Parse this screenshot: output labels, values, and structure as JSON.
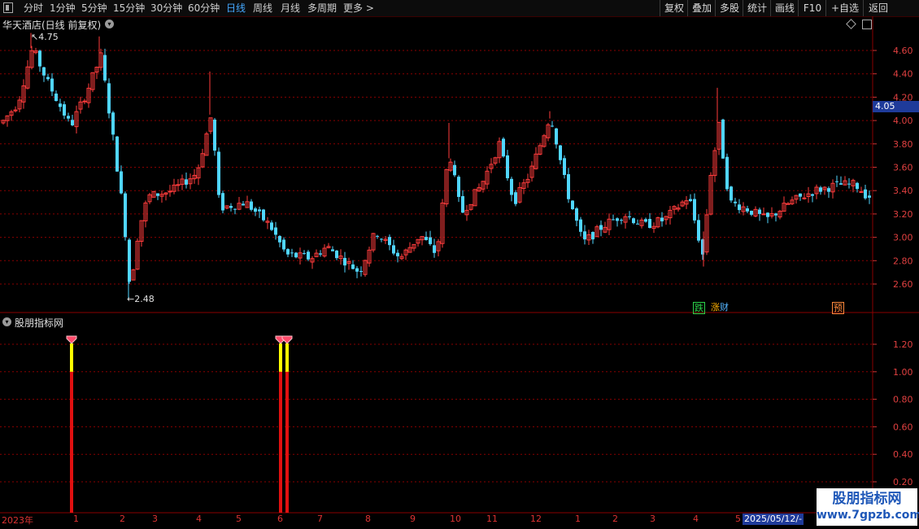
{
  "toolbar": {
    "periods": [
      "分时",
      "1分钟",
      "5分钟",
      "15分钟",
      "30分钟",
      "60分钟",
      "日线",
      "周线",
      "月线",
      "多周期",
      "更多 >"
    ],
    "active_period": "日线",
    "right_buttons": [
      "复权",
      "叠加",
      "多股",
      "统计",
      "画线",
      "F10",
      "+自选",
      "返回"
    ]
  },
  "main_panel": {
    "title": "华天酒店(日线 前复权)",
    "price_axis": [
      "4.60",
      "4.40",
      "4.20",
      "4.00",
      "3.80",
      "3.60",
      "3.40",
      "3.20",
      "3.00",
      "2.80",
      "2.60"
    ],
    "current_price": "4.05",
    "high_label": "4.75",
    "low_label": "2.48",
    "event_tags": [
      {
        "text": "跌",
        "color": "#2bd34a"
      },
      {
        "text": "涨",
        "color": "#ffb000"
      },
      {
        "text": "财",
        "color": "#54b4ff"
      },
      {
        "text": "预",
        "color": "#ff8a3c"
      }
    ]
  },
  "indicator_panel": {
    "title": "股朋指标网",
    "axis": [
      "1.20",
      "1.00",
      "0.80",
      "0.60",
      "0.40",
      "0.20"
    ]
  },
  "time_axis": {
    "labels": [
      "2023年",
      "1",
      "2",
      "3",
      "4",
      "5",
      "6",
      "7",
      "8",
      "9",
      "10",
      "11",
      "12",
      "1",
      "2",
      "3",
      "4",
      "5"
    ],
    "cursor_date": "2025/05/12/-"
  },
  "watermark": {
    "line1": "股朋指标网",
    "line2": "www.7gpzb.com"
  },
  "colors": {
    "up": "#ff3c3c",
    "down": "#50d6ff",
    "grid": "#8a0000",
    "signal_red": "#e01010",
    "signal_yellow": "#ffff00",
    "axis_bg": "#000"
  },
  "icons": [
    "window-icon",
    "collapse-icon",
    "restore-icon"
  ]
}
